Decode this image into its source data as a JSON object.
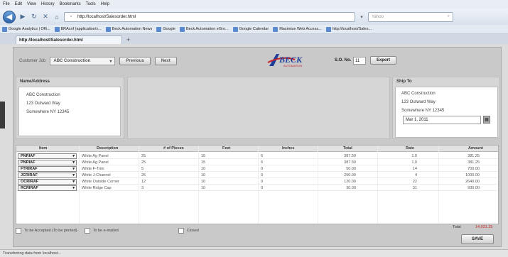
{
  "browser": {
    "menu": [
      "File",
      "Edit",
      "View",
      "History",
      "Bookmarks",
      "Tools",
      "Help"
    ],
    "url": "http://localhost/Salesorder.html",
    "search_placeholder": "Yahoo",
    "bookmarks": [
      "Google Analytics | Offi...",
      "BRAcnf (application/x...",
      "Beck Automation News",
      "Google",
      "Beck Automation eGro...",
      "Google Calendar",
      "Maximize Web Access...",
      "http://localhost/Sales..."
    ],
    "tab_title": "http://localhost/Salesorder.html",
    "status": "Transferring data from localhost..."
  },
  "toolbar": {
    "customer_label": "Customer Job",
    "customer_value": "ABC Construction",
    "previous_label": "Previous",
    "next_label": "Next",
    "so_label": "S.O. No.",
    "so_value": "11",
    "export_label": "Export"
  },
  "logo": {
    "text": "BECK",
    "subtext": "AUTOMATION"
  },
  "name_address": {
    "title": "Name/Address",
    "lines": [
      "ABC Construction",
      "123 Outward Way",
      "Somewhere  NY     12345"
    ]
  },
  "ship_to": {
    "title": "Ship To",
    "lines": [
      "ABC Construction",
      "123 Outward Way",
      "Somewhere      NY             12345"
    ],
    "date": "Mar 1, 2011"
  },
  "grid": {
    "headers": [
      "Item",
      "Description",
      "# of Pieces",
      "Feet",
      "Inches",
      "Total",
      "Rate",
      "Amount"
    ],
    "rows": [
      {
        "item": "PNRIAF",
        "desc": "White Ag Panel",
        "pieces": "25",
        "feet": "15",
        "inches": "6",
        "total": "387.50",
        "rate": "1.0",
        "amount": "381.25"
      },
      {
        "item": "PNRIAF",
        "desc": "White Ag Panel",
        "pieces": "25",
        "feet": "15",
        "inches": "6",
        "total": "387.50",
        "rate": "1.0",
        "amount": "381.25"
      },
      {
        "item": "FTRIRAF",
        "desc": "White F-Trim",
        "pieces": "5",
        "feet": "10",
        "inches": "0",
        "total": "50.00",
        "rate": "14",
        "amount": "700.00"
      },
      {
        "item": "JCRIRAF",
        "desc": "White J-Channel",
        "pieces": "25",
        "feet": "10",
        "inches": "0",
        "total": "250.00",
        "rate": "4",
        "amount": "1000.00"
      },
      {
        "item": "OCRIRAF",
        "desc": "White Outside Corner",
        "pieces": "12",
        "feet": "10",
        "inches": "0",
        "total": "120.00",
        "rate": "22",
        "amount": "2640.00"
      },
      {
        "item": "RCRIRAF",
        "desc": "White Ridge Cap",
        "pieces": "3",
        "feet": "10",
        "inches": "0",
        "total": "30.00",
        "rate": "31",
        "amount": "930.00"
      }
    ]
  },
  "footer": {
    "to_be_accepted": "To be Accepted (To be printed)",
    "to_be_emailed": "To be e-mailed",
    "closed": "Closed",
    "total_label": "Total",
    "total_value": "14,031.25",
    "save_label": "SAVE"
  }
}
